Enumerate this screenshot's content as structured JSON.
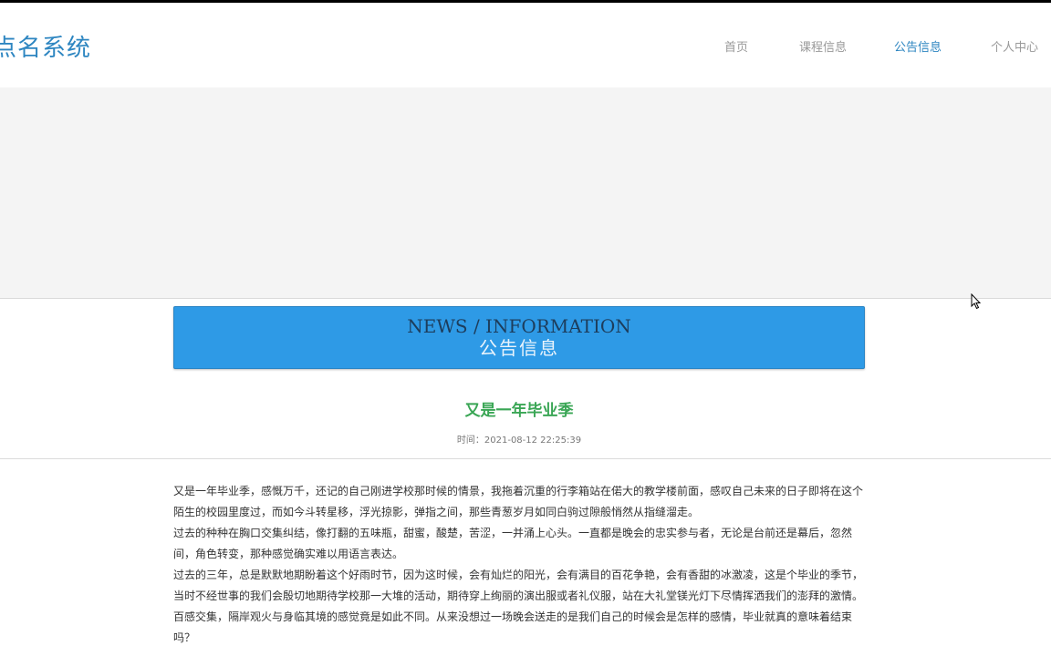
{
  "app": {
    "title": "点名系统"
  },
  "nav": {
    "items": [
      {
        "label": "首页",
        "active": false
      },
      {
        "label": "课程信息",
        "active": false
      },
      {
        "label": "公告信息",
        "active": true
      },
      {
        "label": "个人中心",
        "active": false
      }
    ]
  },
  "section": {
    "title_en": "NEWS / INFORMATION",
    "title_cn": "公告信息"
  },
  "article": {
    "title": "又是一年毕业季",
    "time": "时间：2021-08-12 22:25:39",
    "paragraphs": [
      "又是一年毕业季，感慨万千，还记的自己刚进学校那时候的情景，我拖着沉重的行李箱站在偌大的教学楼前面，感叹自己未来的日子即将在这个陌生的校园里度过，而如今斗转星移，浮光掠影，弹指之间，那些青葱岁月如同白驹过隙般悄然从指缝溜走。",
      "过去的种种在胸口交集纠结，像打翻的五味瓶，甜蜜，酸楚，苦涩，一并涌上心头。一直都是晚会的忠实参与者，无论是台前还是幕后，忽然间，角色转变，那种感觉确实难以用语言表达。",
      "过去的三年，总是默默地期盼着这个好雨时节，因为这时候，会有灿烂的阳光，会有满目的百花争艳，会有香甜的冰激凌，这是个毕业的季节，当时不经世事的我们会殷切地期待学校那一大堆的活动，期待穿上绚丽的演出服或者礼仪服，站在大礼堂镁光灯下尽情挥洒我们的澎拜的激情。",
      "百感交集，隔岸观火与身临其境的感觉竟是如此不同。从来没想过一场晚会送走的是我们自己的时候会是怎样的感情，毕业就真的意味着结束吗？"
    ]
  },
  "colors": {
    "accent": "#2e86c1",
    "banner_bg": "#f4f4f4",
    "section_bg": "#2e9ae6",
    "title_green": "#3aa655"
  }
}
